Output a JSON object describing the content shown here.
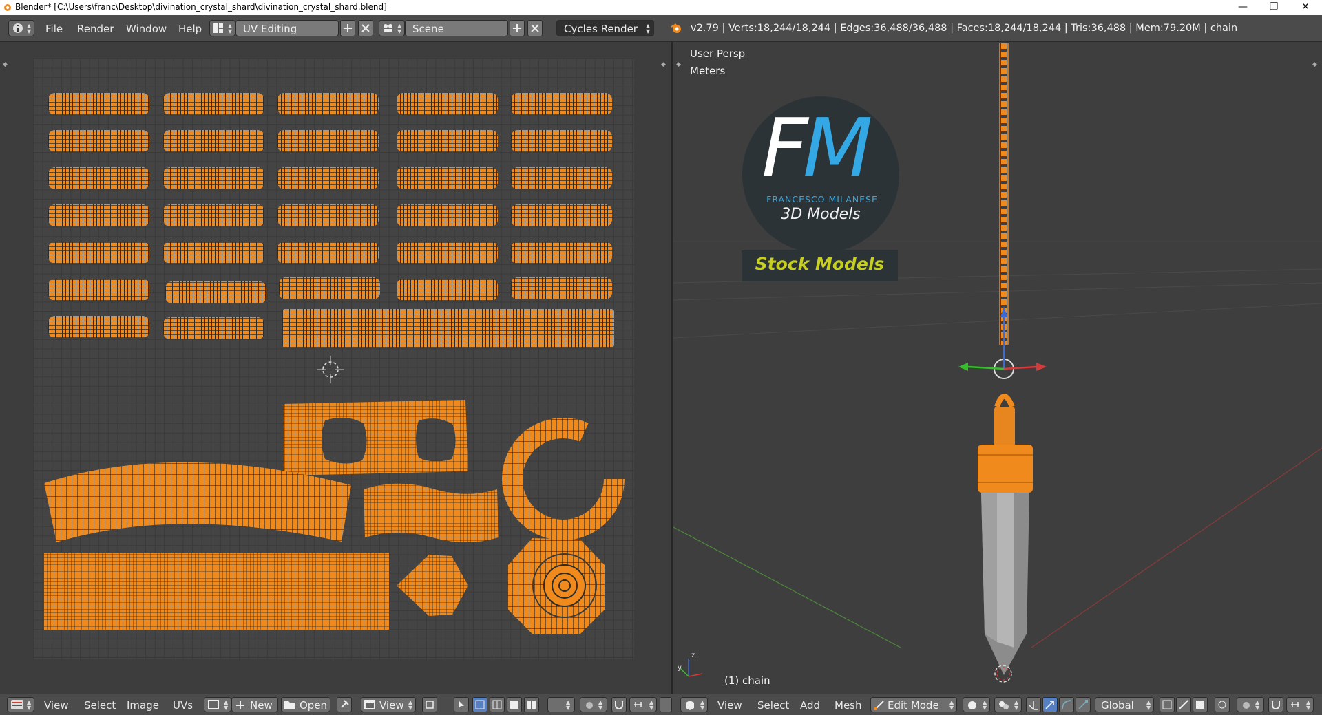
{
  "window": {
    "title": "Blender* [C:\\Users\\franc\\Desktop\\divination_crystal_shard\\divination_crystal_shard.blend]",
    "minimize": "—",
    "maximize": "❐",
    "close": "✕"
  },
  "info_header": {
    "menus": [
      "File",
      "Render",
      "Window",
      "Help"
    ],
    "layout": "UV Editing",
    "scene": "Scene",
    "engine": "Cycles Render",
    "stats": "v2.79 | Verts:18,244/18,244 | Edges:36,488/36,488 | Faces:18,244/18,244 | Tris:36,488 | Mem:79.20M | chain"
  },
  "viewport": {
    "view_name": "User Persp",
    "units": "Meters",
    "object_label": "(1) chain",
    "logo": {
      "fm": "FM",
      "name": "FRANCESCO MILANESE",
      "line2": "3D Models",
      "line3": "Stock Models"
    }
  },
  "uv_footer": {
    "menus": [
      "View",
      "Select",
      "Image",
      "UVs"
    ],
    "new_label": "New",
    "open_label": "Open",
    "view_label": "View"
  },
  "view3d_footer": {
    "menus": [
      "View",
      "Select",
      "Add",
      "Mesh"
    ],
    "mode": "Edit Mode",
    "orientation": "Global"
  },
  "colors": {
    "accent_orange": "#f08a1c",
    "selected_blue": "#5680c2",
    "logo_blue": "#34a8e4",
    "logo_yellow": "#c7d020"
  }
}
